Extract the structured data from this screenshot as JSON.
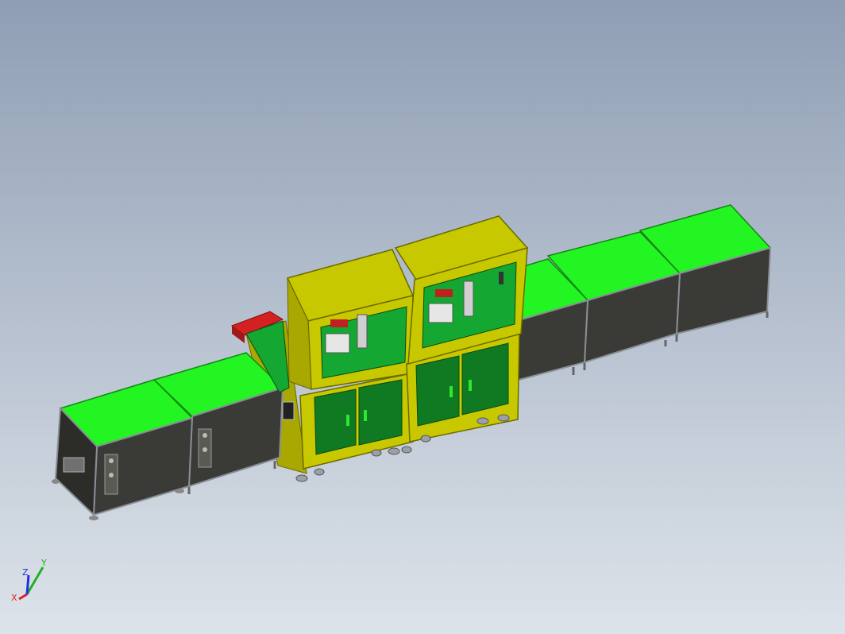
{
  "viewport": {
    "background_top": "#8f9eb4",
    "background_bottom": "#dde3ea"
  },
  "model": {
    "colors": {
      "conveyor_top": "#22f522",
      "conveyor_edge": "#118811",
      "cabinet_body": "#3a3a36",
      "frame": "#8a8f96",
      "enclosure_yellow": "#c8c800",
      "enclosure_yellow_dark": "#8f8f00",
      "cabinet_door_green": "#0f7a22",
      "internal_plate": "#14a832",
      "red_part": "#d42020",
      "handle": "#2ee82e"
    }
  },
  "triad": {
    "x_label": "X",
    "y_label": "Y",
    "z_label": "Z",
    "x_color": "#e02020",
    "y_color": "#20b020",
    "z_color": "#2030e0"
  }
}
